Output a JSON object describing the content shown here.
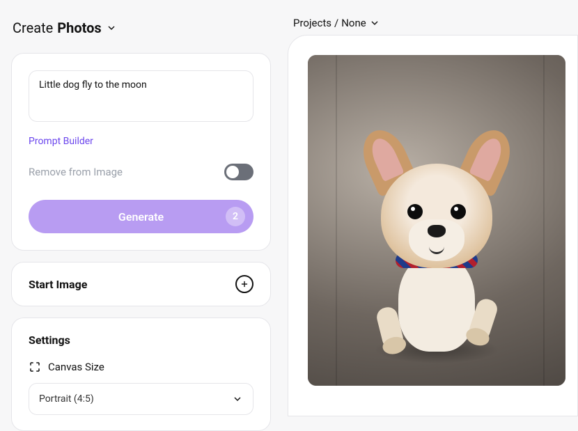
{
  "header": {
    "create_label": "Create",
    "mode_label": "Photos"
  },
  "breadcrumb": {
    "root": "Projects",
    "separator": "/",
    "current": "None"
  },
  "prompt": {
    "value": "Little dog fly to the moon",
    "builder_label": "Prompt Builder",
    "remove_label": "Remove from Image",
    "remove_enabled": false,
    "generate_label": "Generate",
    "generate_count": "2"
  },
  "start_image": {
    "title": "Start Image"
  },
  "settings": {
    "title": "Settings",
    "canvas_size_label": "Canvas Size",
    "canvas_size_value": "Portrait (4:5)"
  }
}
